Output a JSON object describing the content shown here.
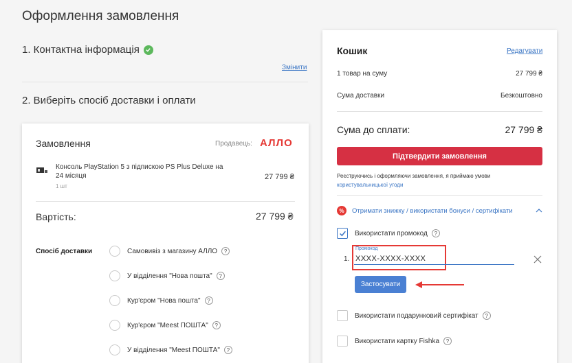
{
  "page": {
    "title": "Оформлення замовлення",
    "step1_title": "1. Контактна інформація",
    "change_link": "Змінити",
    "step2_title": "2. Виберіть спосіб доставки і оплати"
  },
  "order": {
    "title": "Замовлення",
    "seller_label": "Продавець:",
    "seller_logo": "АЛЛО",
    "product_name": "Консоль PlayStation 5 з підпискою PS Plus Deluxe на 24 місяця",
    "product_qty": "1 шт",
    "product_price": "27 799 ₴",
    "cost_label": "Вартість:",
    "cost_value": "27 799 ₴",
    "delivery_label": "Спосіб доставки",
    "delivery_options": [
      "Самовивіз з магазину АЛЛО",
      "У відділення \"Нова пошта\"",
      "Кур'єром \"Нова пошта\"",
      "Кур'єром \"Meest ПОШТА\"",
      "У відділення \"Meest ПОШТА\""
    ]
  },
  "cart": {
    "title": "Кошик",
    "edit_link": "Редагувати",
    "items_label": "1 товар на суму",
    "items_value": "27 799 ₴",
    "delivery_label": "Сума доставки",
    "delivery_value": "Безкоштовно",
    "total_label": "Сума до сплати:",
    "total_value": "27 799 ₴",
    "confirm_button": "Підтвердити замовлення",
    "terms_text": "Реєструючись і оформляючи замовлення, я приймаю умови",
    "terms_link": "користувальницької угоди",
    "discount_toggle": "Отримати знижку / використати бонуси / сертифікати",
    "promo_checkbox_label": "Використати промокод",
    "promo_number": "1.",
    "promo_field_label": "Промокод",
    "promo_value": "XXXX-XXXX-XXXX",
    "apply_button": "Застосувати",
    "gift_cert_label": "Використати подарунковий сертифікат",
    "fishka_label": "Використати картку Fishka"
  },
  "colors": {
    "accent_red": "#d63043",
    "link_blue": "#3a75c4",
    "apply_blue": "#4a80d3",
    "success_green": "#5cb85c",
    "highlight_red": "#e53935"
  }
}
